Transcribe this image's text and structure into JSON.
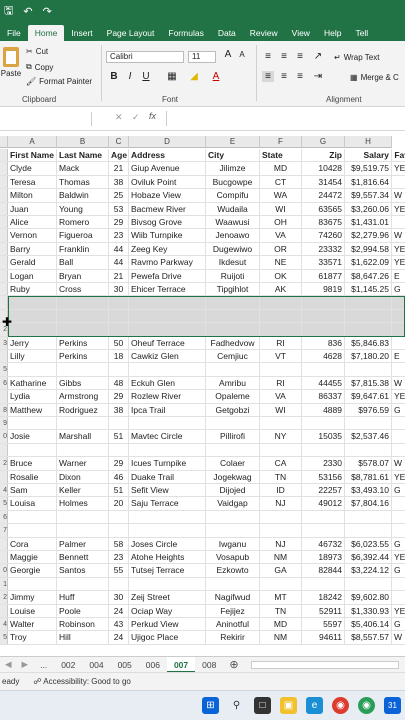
{
  "titlebar": {
    "save_icon": "save-icon",
    "undo_icon": "undo-icon",
    "redo_icon": "redo-icon"
  },
  "tabs": [
    "File",
    "Home",
    "Insert",
    "Page Layout",
    "Formulas",
    "Data",
    "Review",
    "View",
    "Help",
    "Tell"
  ],
  "active_tab": 1,
  "ribbon": {
    "clipboard": {
      "paste": "Paste",
      "cut": "Cut",
      "copy": "Copy",
      "format_painter": "Format Painter",
      "label": "Clipboard"
    },
    "font": {
      "name": "Calibri",
      "size": "11",
      "label": "Font",
      "bold": "B",
      "italic": "I",
      "underline": "U"
    },
    "alignment": {
      "wrap": "Wrap Text",
      "merge": "Merge & C",
      "label": "Alignment"
    }
  },
  "formula_bar": {
    "cancel": "✕",
    "enter": "✓",
    "fx": "fx"
  },
  "columns": [
    "A",
    "B",
    "C",
    "D",
    "E",
    "F",
    "G",
    "H"
  ],
  "headers": [
    "First Name",
    "Last Name",
    "Age",
    "Address",
    "City",
    "State",
    "Zip",
    "Salary",
    "Fav"
  ],
  "row_numbers": [
    "",
    "",
    "",
    "",
    "",
    "",
    "",
    "",
    "",
    "",
    "",
    "",
    "2",
    "3",
    "",
    "5",
    "6",
    "",
    "8",
    "9",
    "0",
    "",
    "2",
    "",
    "4",
    "5",
    "6",
    "7",
    "",
    "",
    "0",
    "1",
    "2",
    "",
    "4",
    "5",
    "6",
    "7"
  ],
  "rows": [
    [
      "Clyde",
      "Mack",
      "21",
      "Giup Avenue",
      "Jilimze",
      "MD",
      "10428",
      "$9,519.75",
      "YE"
    ],
    [
      "Teresa",
      "Thomas",
      "38",
      "Oviluk Point",
      "Bucgowpe",
      "CT",
      "31454",
      "$1,816.64",
      ""
    ],
    [
      "Milton",
      "Baldwin",
      "25",
      "Hobaze View",
      "Compifu",
      "WA",
      "24472",
      "$9,557.34",
      "W"
    ],
    [
      "Juan",
      "Young",
      "53",
      "Bacmew River",
      "Wudaila",
      "WI",
      "63565",
      "$3,260.06",
      "YE"
    ],
    [
      "Alice",
      "Romero",
      "29",
      "Bivsog Grove",
      "Waawusi",
      "OH",
      "83675",
      "$1,431.01",
      ""
    ],
    [
      "Vernon",
      "Figueroa",
      "23",
      "Wiib Turnpike",
      "Jenoawo",
      "VA",
      "74260",
      "$2,279.96",
      "W"
    ],
    [
      "Barry",
      "Franklin",
      "44",
      "Zeeg Key",
      "Dugewiwo",
      "OR",
      "23332",
      "$2,994.58",
      "YE"
    ],
    [
      "Gerald",
      "Ball",
      "44",
      "Ravmo Parkway",
      "Ikdesut",
      "NE",
      "33571",
      "$1,622.09",
      "YE"
    ],
    [
      "Logan",
      "Bryan",
      "21",
      "Pewefa Drive",
      "Ruijoti",
      "OK",
      "61877",
      "$8,647.26",
      "E"
    ],
    [
      "Ruby",
      "Cross",
      "30",
      "Ehicer Terrace",
      "Tipgihlot",
      "AK",
      "9819",
      "$1,145.25",
      "G"
    ],
    [
      "",
      "",
      "",
      "",
      "",
      "",
      "",
      "",
      ""
    ],
    [
      "",
      "",
      "",
      "",
      "",
      "",
      "",
      "",
      ""
    ],
    [
      "",
      "",
      "",
      "",
      "",
      "",
      "",
      "",
      ""
    ],
    [
      "Jerry",
      "Perkins",
      "50",
      "Oheuf Terrace",
      "Fadhedvow",
      "RI",
      "836",
      "$5,846.83",
      ""
    ],
    [
      "Lilly",
      "Perkins",
      "18",
      "Cawkiz Glen",
      "Cemjiuc",
      "VT",
      "4628",
      "$7,180.20",
      "E"
    ],
    [
      "",
      "",
      "",
      "",
      "",
      "",
      "",
      "",
      ""
    ],
    [
      "Katharine",
      "Gibbs",
      "48",
      "Eckuh Glen",
      "Amribu",
      "RI",
      "44455",
      "$7,815.38",
      "W"
    ],
    [
      "Lydia",
      "Armstrong",
      "29",
      "Rozlew River",
      "Opaleme",
      "VA",
      "86337",
      "$9,647.61",
      "YE"
    ],
    [
      "Matthew",
      "Rodriguez",
      "38",
      "Ipca Trail",
      "Getgobzi",
      "WI",
      "4889",
      "$976.59",
      "G"
    ],
    [
      "",
      "",
      "",
      "",
      "",
      "",
      "",
      "",
      ""
    ],
    [
      "Josie",
      "Marshall",
      "51",
      "Mavtec Circle",
      "Pillirofi",
      "NY",
      "15035",
      "$2,537.46",
      ""
    ],
    [
      "",
      "",
      "",
      "",
      "",
      "",
      "",
      "",
      ""
    ],
    [
      "Bruce",
      "Warner",
      "29",
      "Icues Turnpike",
      "Colaer",
      "CA",
      "2330",
      "$578.07",
      "W"
    ],
    [
      "Rosalie",
      "Dixon",
      "46",
      "Duake Trail",
      "Jogekwag",
      "TN",
      "53156",
      "$8,781.61",
      "YE"
    ],
    [
      "Sam",
      "Keller",
      "51",
      "Sefit View",
      "Dijojed",
      "ID",
      "22257",
      "$3,493.10",
      "G"
    ],
    [
      "Louisa",
      "Holmes",
      "20",
      "Saju Terrace",
      "Vaidgap",
      "NJ",
      "49012",
      "$7,804.16",
      ""
    ],
    [
      "",
      "",
      "",
      "",
      "",
      "",
      "",
      "",
      ""
    ],
    [
      "",
      "",
      "",
      "",
      "",
      "",
      "",
      "",
      ""
    ],
    [
      "Cora",
      "Palmer",
      "58",
      "Joses Circle",
      "Iwganu",
      "NJ",
      "46732",
      "$6,023.55",
      "G"
    ],
    [
      "Maggie",
      "Bennett",
      "23",
      "Atohe Heights",
      "Vosapub",
      "NM",
      "18973",
      "$6,392.44",
      "YE"
    ],
    [
      "Georgie",
      "Santos",
      "55",
      "Tutsej Terrace",
      "Ezkowto",
      "GA",
      "82844",
      "$3,224.12",
      "G"
    ],
    [
      "",
      "",
      "",
      "",
      "",
      "",
      "",
      "",
      ""
    ],
    [
      "Jimmy",
      "Huff",
      "30",
      "Zeij Street",
      "Nagifwud",
      "MT",
      "18242",
      "$9,602.80",
      ""
    ],
    [
      "Louise",
      "Poole",
      "24",
      "Ociap Way",
      "Fejijez",
      "TN",
      "52911",
      "$1,330.93",
      "YE"
    ],
    [
      "Walter",
      "Robinson",
      "43",
      "Perkud View",
      "Aninotful",
      "MD",
      "5597",
      "$5,406.14",
      "G"
    ],
    [
      "Troy",
      "Hill",
      "24",
      "Ujigoc Place",
      "Rekirir",
      "NM",
      "94611",
      "$8,557.57",
      "W"
    ]
  ],
  "sheets": [
    "...",
    "002",
    "004",
    "005",
    "006",
    "007",
    "008"
  ],
  "active_sheet": 5,
  "status": {
    "ready": "eady",
    "accessibility": "Accessibility: Good to go"
  },
  "taskbar": {
    "date_badge": "31"
  }
}
